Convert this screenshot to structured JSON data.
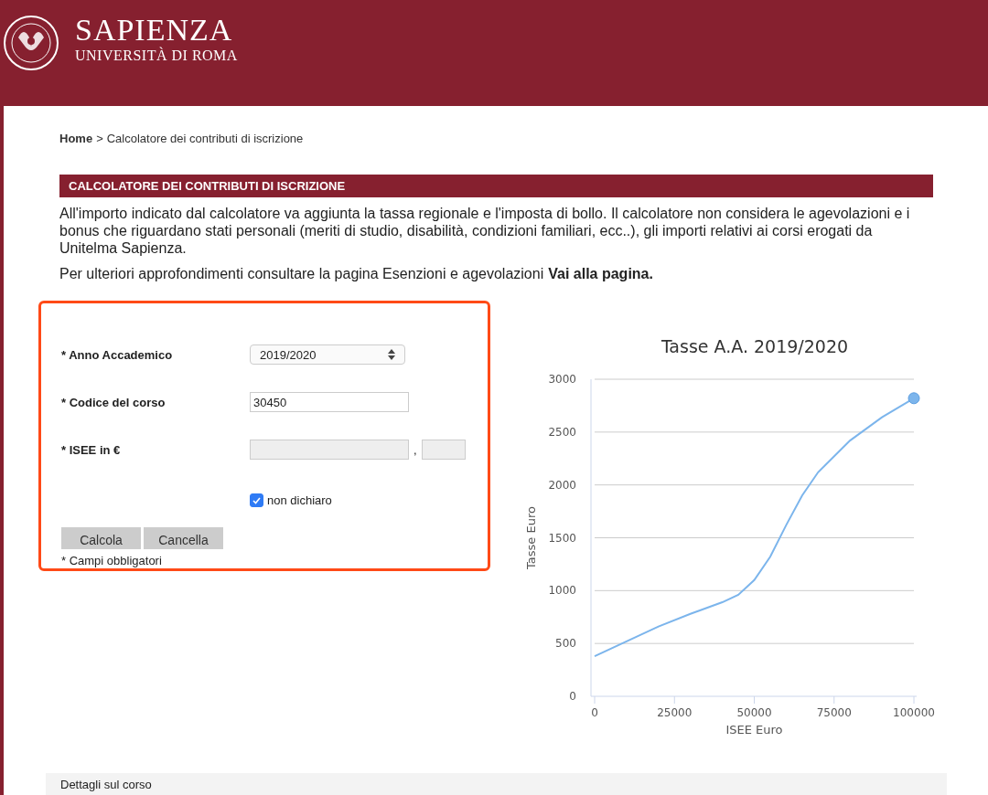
{
  "header": {
    "title": "SAPIENZA",
    "subtitle": "UNIVERSITÀ DI ROMA"
  },
  "breadcrumb": {
    "home": "Home",
    "separator": ">",
    "current": "Calcolatore dei contributi di iscrizione"
  },
  "section_title": "CALCOLATORE DEI CONTRIBUTI DI ISCRIZIONE",
  "intro": "All'importo indicato dal calcolatore va aggiunta la tassa regionale e l'imposta di bollo. Il calcolatore non considera le agevolazioni e i bonus che riguardano stati personali (meriti di studio, disabilità, condizioni familiari, ecc..), gli importi relativi ai corsi erogati da Unitelma Sapienza.",
  "more_info": {
    "text": "Per ulteriori approfondimenti consultare la pagina Esenzioni e agevolazioni",
    "link": "Vai alla pagina."
  },
  "form": {
    "fields": [
      {
        "kind": "select",
        "label": "* Anno Accademico",
        "value": "2019/2020"
      },
      {
        "kind": "text",
        "label": "* Codice del corso",
        "value": "30450"
      },
      {
        "kind": "money",
        "label": "* ISEE in €",
        "separator": ",",
        "disabled": true
      }
    ],
    "checkbox": {
      "label": "non dichiaro",
      "checked": true
    },
    "buttons": [
      "Calcola",
      "Cancella"
    ],
    "note": "* Campi obbligatori"
  },
  "chart": {
    "chart_data": {
      "type": "line",
      "title": "Tasse A.A. 2019/2020",
      "xlabel": "ISEE Euro",
      "ylabel": "Tasse Euro",
      "x": [
        0,
        10000,
        20000,
        30000,
        40000,
        45000,
        50000,
        55000,
        60000,
        65000,
        70000,
        80000,
        90000,
        100000
      ],
      "grid": true,
      "series": [
        {
          "color": "#7cb5ec",
          "values": [
            380,
            520,
            660,
            780,
            890,
            960,
            1100,
            1320,
            1620,
            1900,
            2120,
            2420,
            2640,
            2820
          ]
        }
      ],
      "xlim": [
        0,
        100000
      ],
      "ylim": [
        0,
        3000
      ],
      "xticks": [
        0,
        25000,
        50000,
        75000,
        100000
      ],
      "yticks": [
        0,
        500,
        1000,
        1500,
        2000,
        2500,
        3000
      ]
    }
  },
  "details": {
    "title": "Dettagli sul corso"
  }
}
